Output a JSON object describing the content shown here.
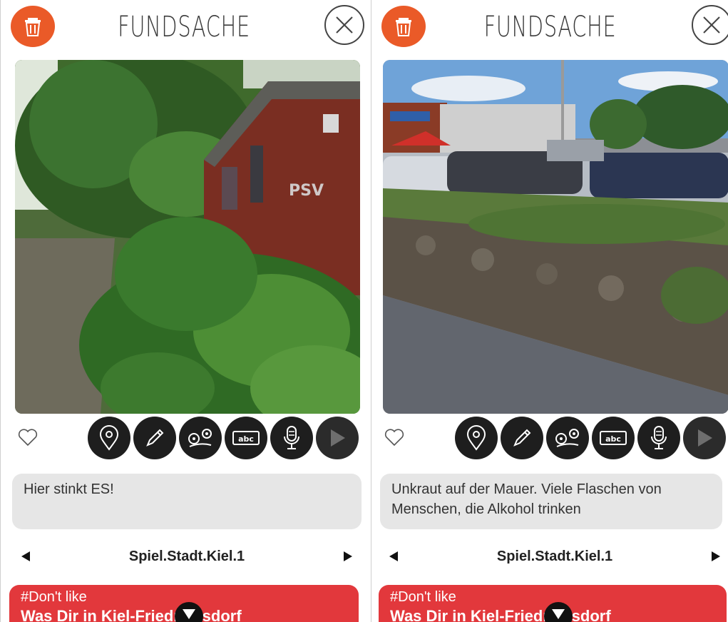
{
  "colors": {
    "accent_orange": "#ea5a28",
    "tag_red": "#e2383c",
    "tool_dark": "#1e1e1e",
    "note_gray": "#e6e6e6"
  },
  "screens": [
    {
      "title": "FUNDSACHE",
      "photo_subject": "brick utility hut with graffiti, green shrubs and a footpath",
      "note": "Hier stinkt ES!",
      "nav_title": "Spiel.Stadt.Kiel.1",
      "tag_label": "#Don't like",
      "tag_subtitle": "Was Dir in Kiel-Friedrichsdorf"
    },
    {
      "title": "FUNDSACHE",
      "photo_subject": "overgrown stone wall beside a parking lot with cars",
      "note": "Unkraut auf der Mauer. Viele Flaschen von Menschen, die Alkohol trinken",
      "nav_title": "Spiel.Stadt.Kiel.1",
      "tag_label": "#Don't like",
      "tag_subtitle": "Was Dir in Kiel-Friedrichsdorf"
    }
  ],
  "toolbar_icons": [
    "location-pin-icon",
    "pencil-icon",
    "map-pin-icon",
    "keyboard-icon",
    "microphone-icon",
    "play-icon"
  ]
}
